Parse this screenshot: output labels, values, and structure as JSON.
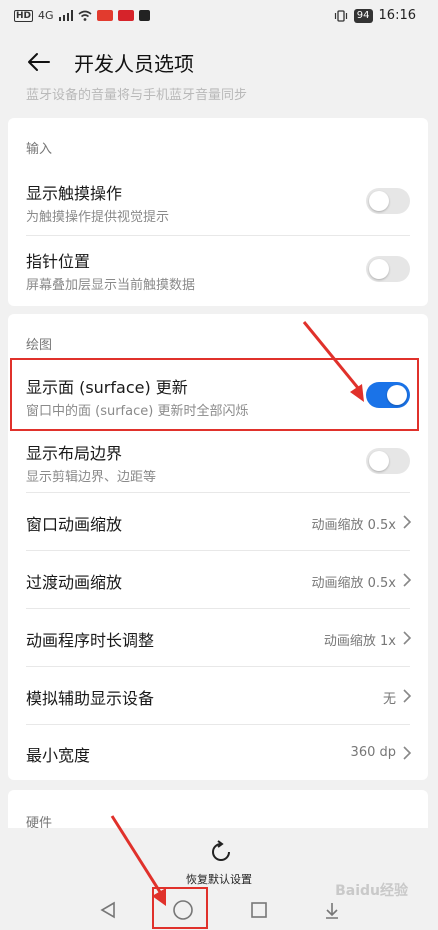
{
  "status_bar": {
    "left_glyphs": [
      "HD",
      "4G"
    ],
    "battery": "94",
    "time": "16:16"
  },
  "app_bar": {
    "title": "开发人员选项"
  },
  "faded_text": "蓝牙设备的音量将与手机蓝牙音量同步",
  "input_section": {
    "label": "输入",
    "items": [
      {
        "title": "显示触摸操作",
        "subtitle": "为触摸操作提供视觉提示",
        "enabled": false
      },
      {
        "title": "指针位置",
        "subtitle": "屏幕叠加层显示当前触摸数据",
        "enabled": false
      }
    ]
  },
  "drawing_section": {
    "label": "绘图",
    "items": [
      {
        "title": "显示面 (surface) 更新",
        "subtitle": "窗口中的面 (surface) 更新时全部闪烁",
        "enabled": true
      },
      {
        "title": "显示布局边界",
        "subtitle": "显示剪辑边界、边距等",
        "enabled": false
      }
    ],
    "value_items": [
      {
        "title": "窗口动画缩放",
        "value": "动画缩放 0.5x"
      },
      {
        "title": "过渡动画缩放",
        "value": "动画缩放 0.5x"
      },
      {
        "title": "动画程序时长调整",
        "value": "动画缩放 1x"
      },
      {
        "title": "模拟辅助显示设备",
        "value": "无"
      },
      {
        "title": "最小宽度",
        "value": "360 dp"
      }
    ]
  },
  "hardware_section": {
    "label": "硬件"
  },
  "bottom_action": {
    "label": "恢复默认设置"
  },
  "watermark": "Baidu经验",
  "colors": {
    "accent": "#1a73e8",
    "highlight": "#e0312b"
  }
}
